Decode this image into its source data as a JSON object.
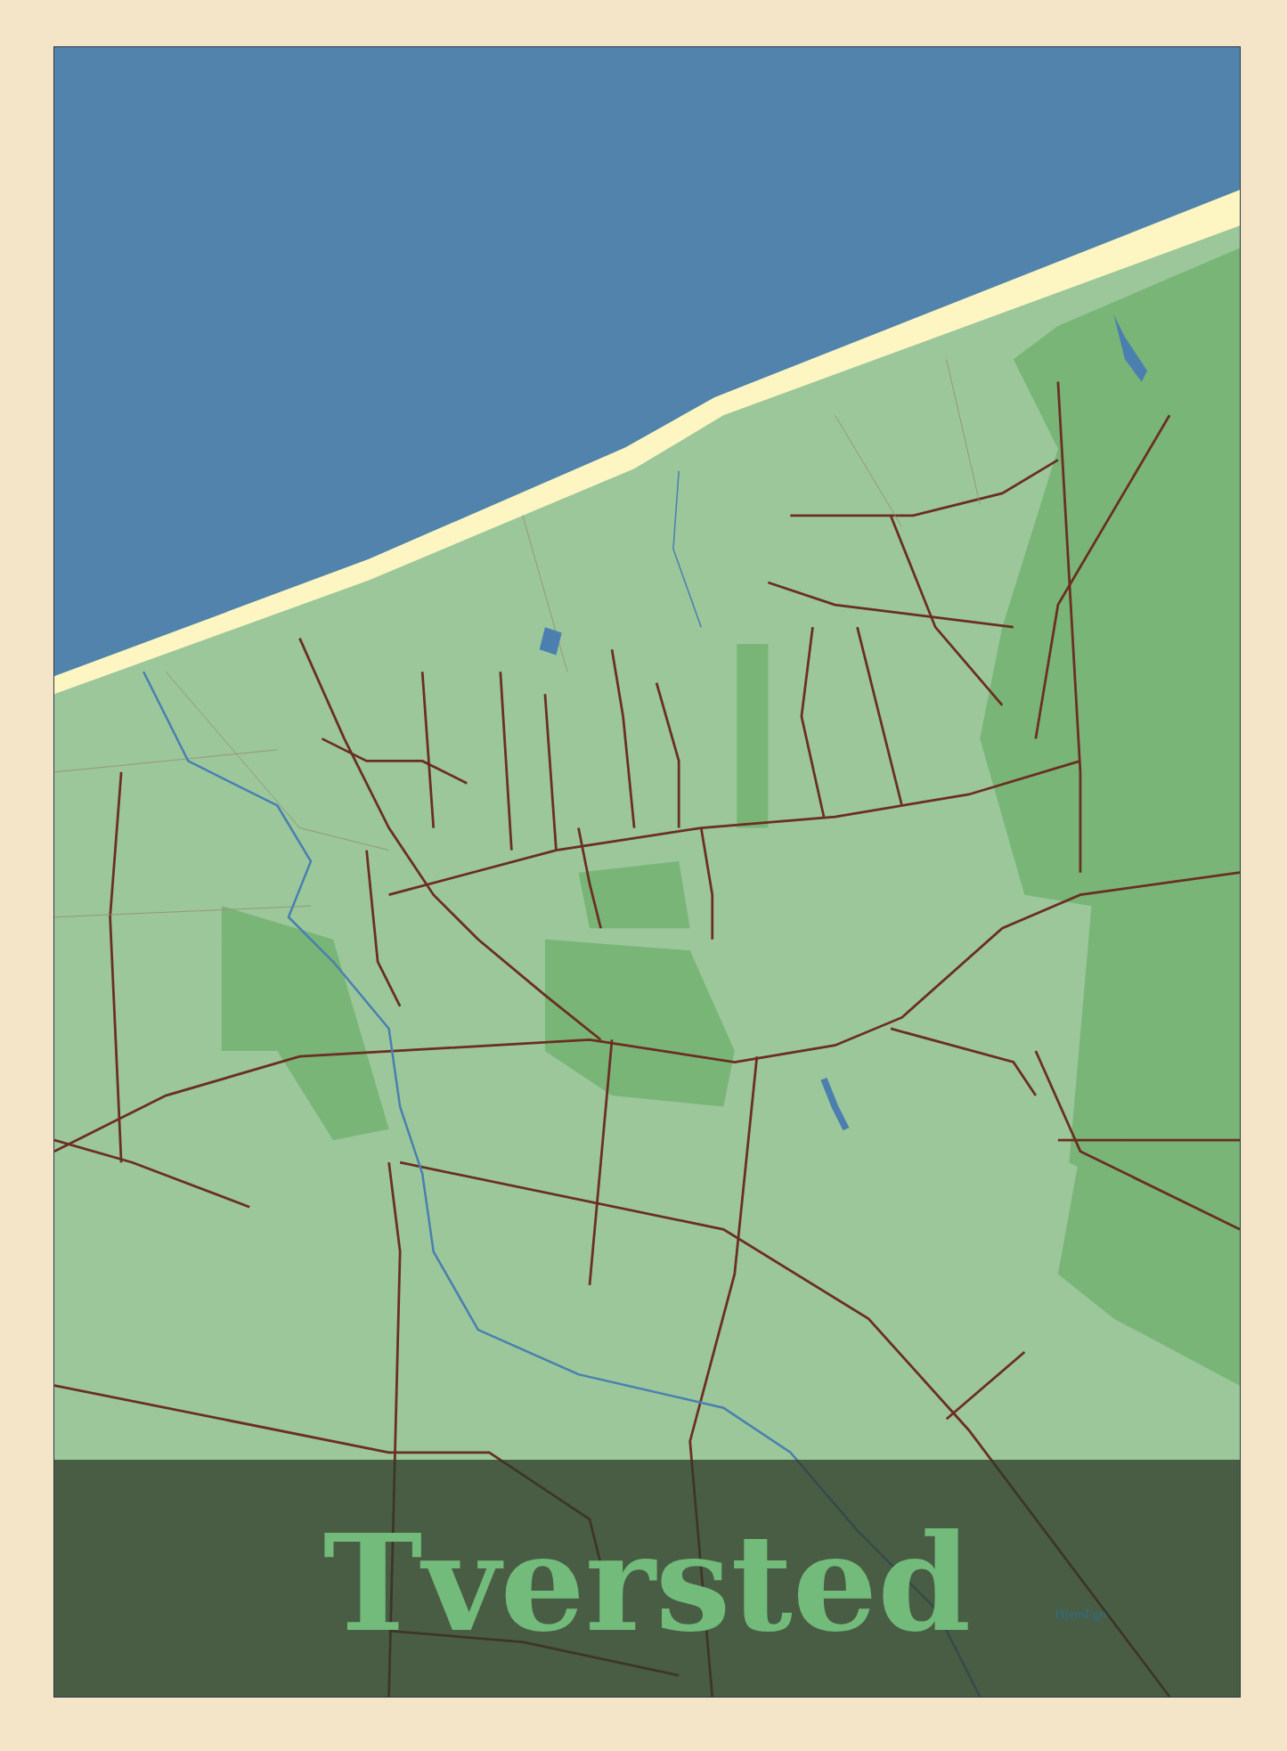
{
  "poster": {
    "title": "Tversted",
    "brand": "HjemEgn"
  }
}
